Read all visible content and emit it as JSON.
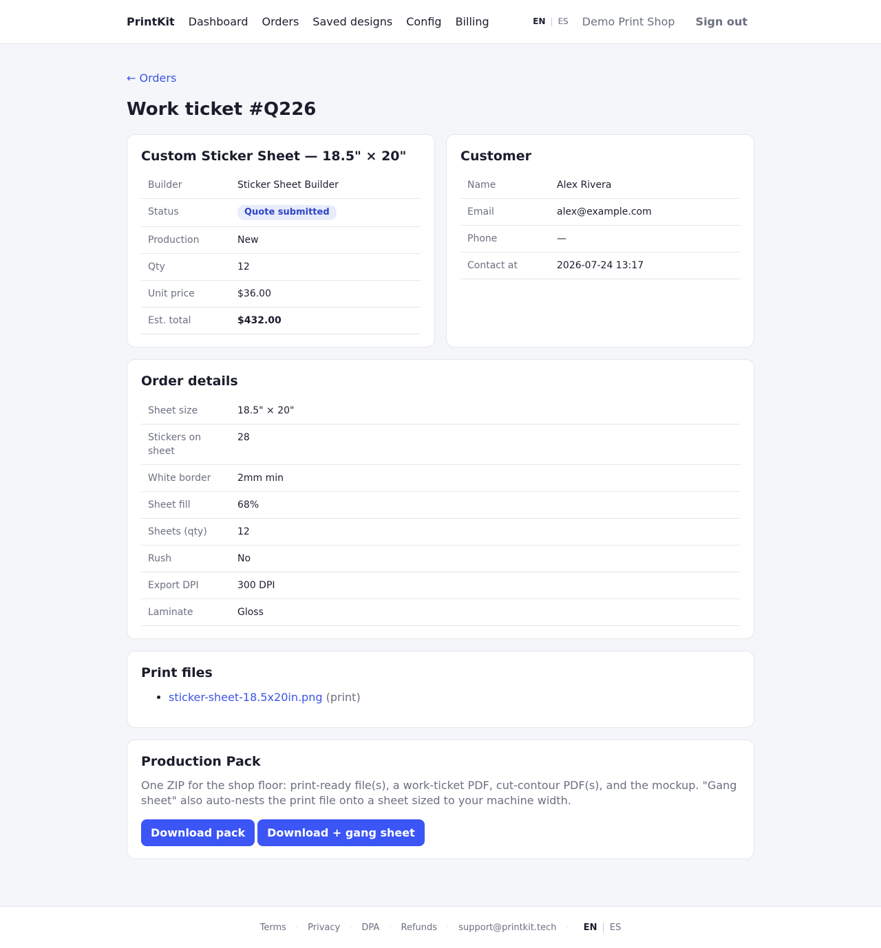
{
  "nav": {
    "brand": "PrintKit",
    "links": [
      "Dashboard",
      "Orders",
      "Saved designs",
      "Config",
      "Billing"
    ],
    "lang_active": "EN",
    "lang_sep": "|",
    "lang_other": "ES",
    "shop_name": "Demo Print Shop",
    "signout": "Sign out"
  },
  "back_link": "← Orders",
  "page_title": "Work ticket #Q226",
  "product_card": {
    "title": "Custom Sticker Sheet — 18.5\" × 20\"",
    "rows": [
      {
        "label": "Builder",
        "value": "Sticker Sheet Builder"
      },
      {
        "label": "Status",
        "value": "Quote submitted"
      },
      {
        "label": "Production",
        "value": "New"
      },
      {
        "label": "Qty",
        "value": "12"
      },
      {
        "label": "Unit price",
        "value": "$36.00"
      },
      {
        "label": "Est. total",
        "value": "$432.00"
      }
    ]
  },
  "customer_card": {
    "title": "Customer",
    "rows": [
      {
        "label": "Name",
        "value": "Alex Rivera"
      },
      {
        "label": "Email",
        "value": "alex@example.com"
      },
      {
        "label": "Phone",
        "value": "—"
      },
      {
        "label": "Contact at",
        "value": "2026-07-24 13:17"
      }
    ]
  },
  "order_details": {
    "title": "Order details",
    "rows": [
      {
        "label": "Sheet size",
        "value": "18.5\" × 20\""
      },
      {
        "label": "Stickers on sheet",
        "value": "28"
      },
      {
        "label": "White border",
        "value": "2mm min"
      },
      {
        "label": "Sheet fill",
        "value": "68%"
      },
      {
        "label": "Sheets (qty)",
        "value": "12"
      },
      {
        "label": "Rush",
        "value": "No"
      },
      {
        "label": "Export DPI",
        "value": "300 DPI"
      },
      {
        "label": "Laminate",
        "value": "Gloss"
      }
    ]
  },
  "print_files": {
    "title": "Print files",
    "files": [
      {
        "name": "sticker-sheet-18.5x20in.png",
        "kind": "(print)"
      }
    ]
  },
  "production_pack": {
    "title": "Production Pack",
    "description": "One ZIP for the shop floor: print-ready file(s), a work-ticket PDF, cut-contour PDF(s), and the mockup. \"Gang sheet\" also auto-nests the print file onto a sheet sized to your machine width.",
    "download_pack": "Download pack",
    "download_gang": "Download + gang sheet"
  },
  "footer": {
    "links": [
      "Terms",
      "Privacy",
      "DPA",
      "Refunds",
      "support@printkit.tech"
    ],
    "dot": "·",
    "lang_active": "EN",
    "lang_sep": "|",
    "lang_other": "ES"
  },
  "colors": {
    "accent": "#3b55f6",
    "link": "#3b55e6",
    "badge_bg": "#e8ecfb",
    "page_bg": "#f5f6f9"
  }
}
